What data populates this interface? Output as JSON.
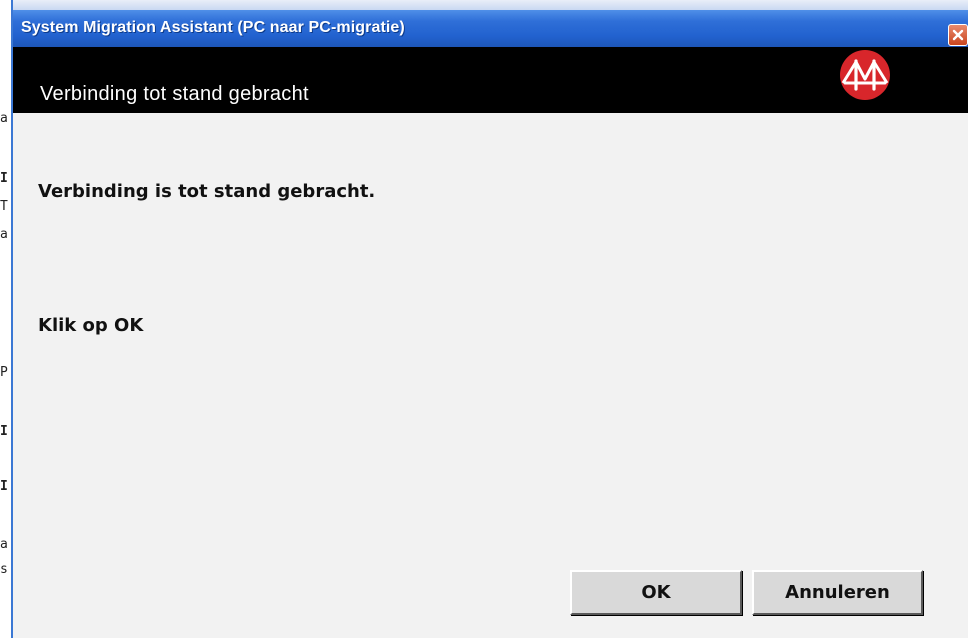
{
  "window": {
    "title": "System Migration Assistant (PC naar PC-migratie)",
    "close_symbol": "✕"
  },
  "header": {
    "title": "Verbinding tot stand gebracht",
    "logo_icon": "migration-bridge-logo-icon"
  },
  "content": {
    "message": "Verbinding is tot stand gebracht.",
    "instruction": "Klik op OK"
  },
  "buttons": {
    "ok_label": "OK",
    "cancel_label": "Annuleren"
  },
  "background_window": {
    "edge_chars": [
      "a",
      "I",
      "T",
      "a",
      "P",
      "I",
      "I",
      "a",
      "s"
    ]
  },
  "colors": {
    "titlebar": "#2262cf",
    "header_band": "#000000",
    "logo_red": "#d8262b",
    "close_button": "#c9451f"
  }
}
